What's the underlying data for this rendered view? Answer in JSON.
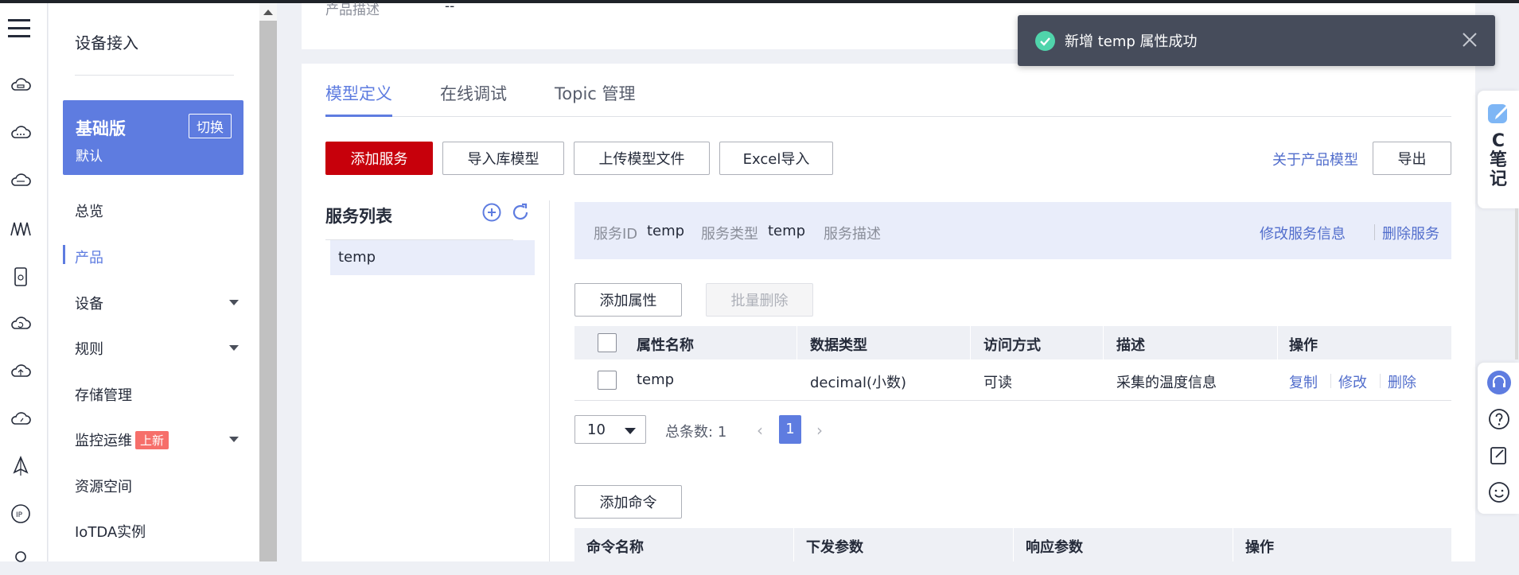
{
  "nav": {
    "title": "设备接入",
    "edition_name": "基础版",
    "edition_sub": "默认",
    "switch_label": "切换",
    "items": [
      {
        "label": "总览"
      },
      {
        "label": "产品"
      },
      {
        "label": "设备"
      },
      {
        "label": "规则"
      },
      {
        "label": "存储管理"
      },
      {
        "label": "监控运维",
        "badge": "上新"
      },
      {
        "label": "资源空间"
      },
      {
        "label": "IoTDA实例"
      }
    ]
  },
  "product_info": {
    "label": "产品描述",
    "value": "--"
  },
  "tabs": [
    {
      "label": "模型定义"
    },
    {
      "label": "在线调试"
    },
    {
      "label": "Topic 管理"
    }
  ],
  "toolbar": {
    "add_service": "添加服务",
    "import_model": "导入库模型",
    "upload_model": "上传模型文件",
    "excel_import": "Excel导入",
    "about_model": "关于产品模型",
    "export": "导出"
  },
  "services": {
    "title": "服务列表",
    "items": [
      "temp"
    ]
  },
  "service_info": {
    "id_label": "服务ID",
    "id_value": "temp",
    "type_label": "服务类型",
    "type_value": "temp",
    "desc_label": "服务描述",
    "edit_link": "修改服务信息",
    "delete_link": "删除服务"
  },
  "properties": {
    "add_btn": "添加属性",
    "batch_delete_btn": "批量删除",
    "columns": [
      "属性名称",
      "数据类型",
      "访问方式",
      "描述",
      "操作"
    ],
    "rows": [
      {
        "name": "temp",
        "type": "decimal(小数)",
        "access": "可读",
        "desc": "采集的温度信息",
        "ops": [
          "复制",
          "修改",
          "删除"
        ]
      }
    ]
  },
  "pager": {
    "page_size": "10",
    "total_label": "总条数:",
    "total": "1",
    "current_page": "1"
  },
  "commands": {
    "add_btn": "添加命令",
    "columns": [
      "命令名称",
      "下发参数",
      "响应参数",
      "操作"
    ]
  },
  "toast": {
    "message": "新增 temp 属性成功"
  },
  "float_note": {
    "label": "C笔记"
  },
  "colors": {
    "primary": "#5e7ce0",
    "danger": "#c7000b",
    "toast_bg": "#464c5b",
    "success": "#50d4ab"
  }
}
